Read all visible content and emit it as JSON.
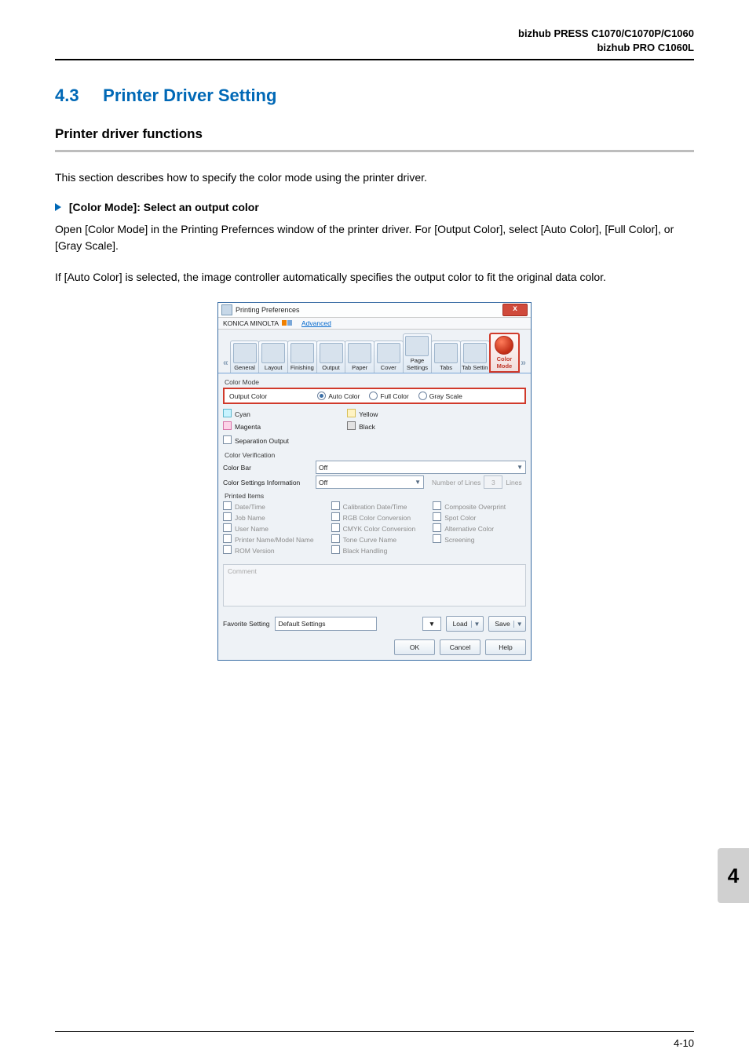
{
  "header": {
    "line1": "bizhub PRESS C1070/C1070P/C1060",
    "line2": "bizhub PRO C1060L"
  },
  "section": {
    "number": "4.3",
    "title": "Printer Driver Setting"
  },
  "subsection": {
    "title": "Printer driver functions"
  },
  "intro": "This section describes how to specify the color mode using the printer driver.",
  "step": {
    "heading": "[Color Mode]: Select an output color",
    "p1": "Open [Color Mode] in the Printing Prefernces window of the printer driver. For [Output Color], select [Auto Color], [Full Color], or [Gray Scale].",
    "p2": "If [Auto Color] is selected, the image controller automatically specifies the output color to fit the original data color."
  },
  "dialog": {
    "title": "Printing Preferences",
    "close_glyph": "x",
    "brand": "KONICA MINOLTA",
    "advanced": "Advanced",
    "tabs": {
      "left_chev": "«",
      "right_chev": "»",
      "items": [
        {
          "label": "General"
        },
        {
          "label": "Layout"
        },
        {
          "label": "Finishing"
        },
        {
          "label": "Output"
        },
        {
          "label": "Paper"
        },
        {
          "label": "Cover"
        },
        {
          "label": "Page Settings"
        },
        {
          "label": "Tabs"
        },
        {
          "label": "Tab Settin"
        },
        {
          "label": "Color Mode"
        }
      ],
      "active_index": 9
    },
    "pane": {
      "group_label": "Color Mode",
      "output_color": {
        "label": "Output Color",
        "options": [
          {
            "label": "Auto Color",
            "selected": true
          },
          {
            "label": "Full Color",
            "selected": false
          },
          {
            "label": "Gray Scale",
            "selected": false
          }
        ]
      },
      "ink": {
        "cyan": "Cyan",
        "magenta": "Magenta",
        "yellow": "Yellow",
        "black": "Black"
      },
      "separation": "Separation Output",
      "color_verification": "Color Verification",
      "color_bar": {
        "label": "Color Bar",
        "value": "Off"
      },
      "color_settings_info": {
        "label": "Color Settings Information",
        "value": "Off"
      },
      "num_lines": {
        "label": "Number of Lines",
        "value": "3",
        "unit": "Lines"
      },
      "printed_items": {
        "label": "Printed Items",
        "col1": [
          "Date/Time",
          "Job Name",
          "User Name",
          "Printer Name/Model Name",
          "ROM Version"
        ],
        "col2": [
          "Calibration Date/Time",
          "RGB Color Conversion",
          "CMYK Color Conversion",
          "Tone Curve Name",
          "Black Handling"
        ],
        "col3": [
          "Composite Overprint",
          "Spot Color",
          "Alternative Color",
          "Screening"
        ]
      },
      "comment_label": "Comment"
    },
    "footer": {
      "fav_label": "Favorite Setting",
      "fav_value": "Default Settings",
      "load": "Load",
      "save": "Save",
      "ok": "OK",
      "cancel": "Cancel",
      "help": "Help"
    }
  },
  "chapter_tab": "4",
  "page_number": "4-10"
}
